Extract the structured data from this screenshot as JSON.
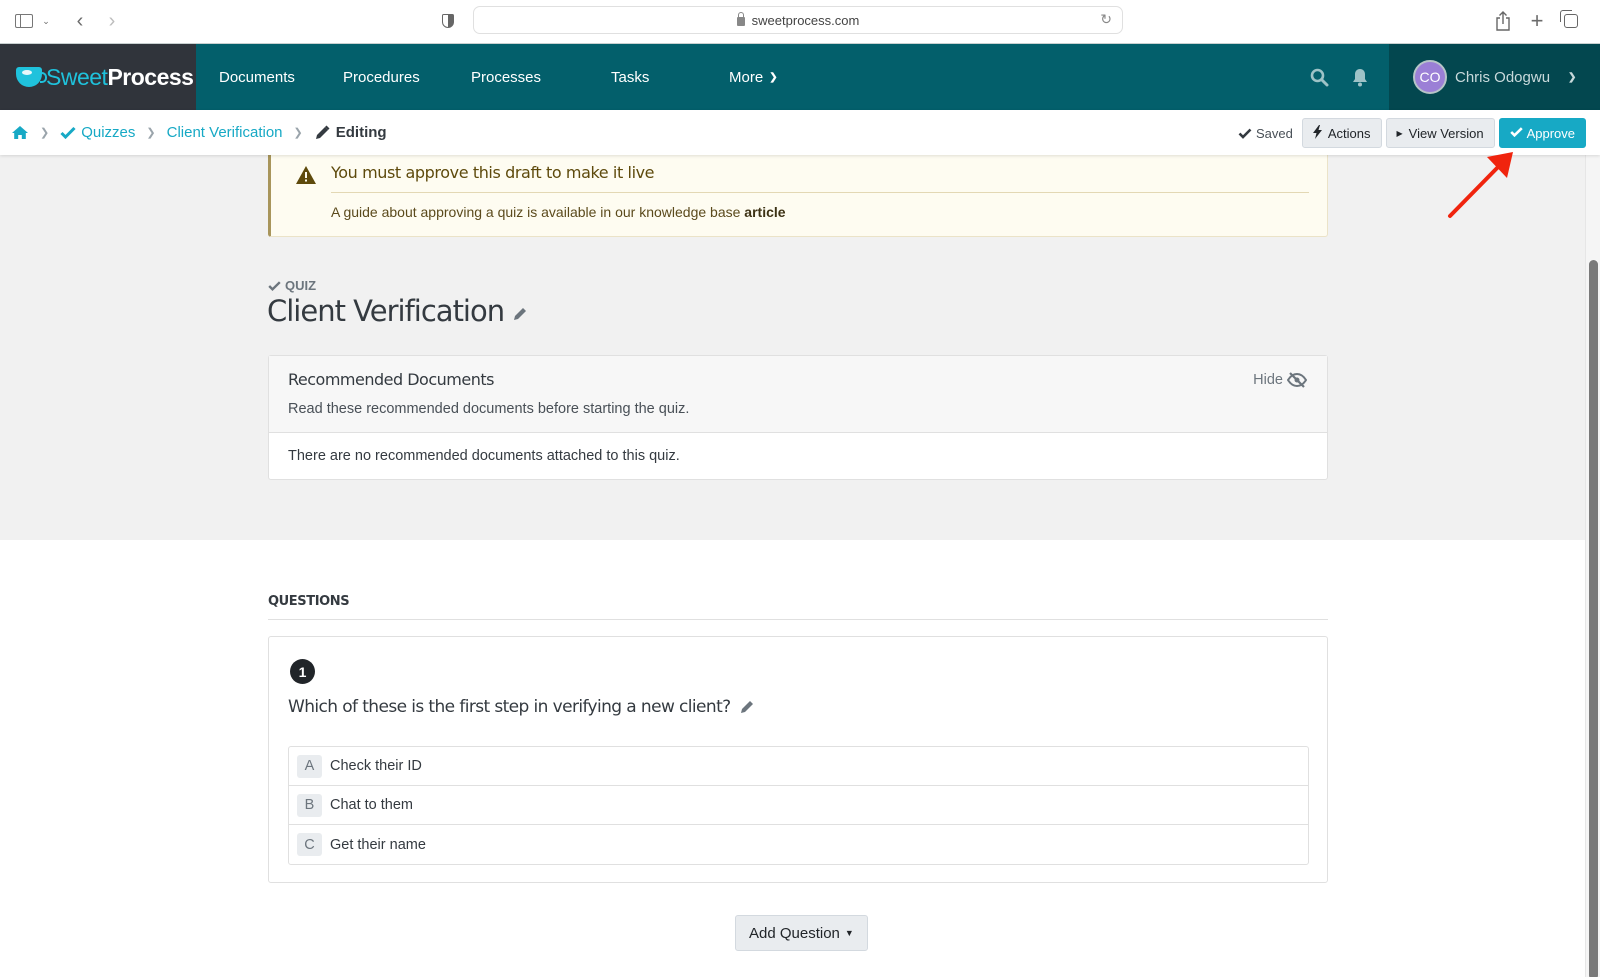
{
  "browser": {
    "url": "sweetprocess.com"
  },
  "navbar": {
    "logo": {
      "part1": "Sweet",
      "part2": "Process"
    },
    "items": [
      {
        "label": "Documents"
      },
      {
        "label": "Procedures"
      },
      {
        "label": "Processes"
      },
      {
        "label": "Tasks"
      },
      {
        "label": "More"
      }
    ],
    "user": {
      "initials": "CO",
      "name": "Chris Odogwu"
    },
    "colors": {
      "nav_bg": "#035f6b",
      "logo_bg": "#30343b",
      "user_bg": "#03474f",
      "accent": "#1fc2dc"
    }
  },
  "breadcrumb": {
    "items": [
      {
        "label": "Quizzes"
      },
      {
        "label": "Client Verification"
      }
    ],
    "current": "Editing"
  },
  "toolbar": {
    "saved_label": "Saved",
    "actions_label": "Actions",
    "view_version_label": "View Version",
    "approve_label": "Approve",
    "approve_color": "#17a9c5"
  },
  "alert": {
    "title": "You must approve this draft to make it live",
    "body_prefix": "A guide about approving a quiz is available in our knowledge base ",
    "link_label": "article"
  },
  "document": {
    "type_label": "QUIZ",
    "title": "Client Verification"
  },
  "recommended": {
    "title": "Recommended Documents",
    "subtitle": "Read these recommended documents before starting the quiz.",
    "hide_label": "Hide",
    "empty_message": "There are no recommended documents attached to this quiz."
  },
  "questions": {
    "heading": "QUESTIONS",
    "items": [
      {
        "number": "1",
        "text": "Which of these is the first step in verifying a new client?",
        "answers": [
          {
            "letter": "A",
            "text": "Check their ID"
          },
          {
            "letter": "B",
            "text": "Chat to them"
          },
          {
            "letter": "C",
            "text": "Get their name"
          }
        ]
      }
    ],
    "add_label": "Add Question"
  }
}
